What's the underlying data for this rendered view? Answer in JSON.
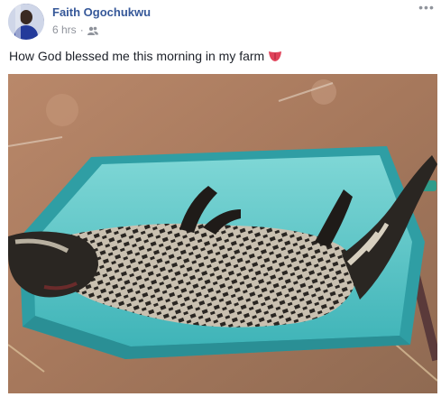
{
  "post": {
    "author_name": "Faith Ogochukwu",
    "timestamp": "6 hrs",
    "separator": "·",
    "audience_icon": "friends-icon",
    "more_icon": "ellipsis-icon",
    "more_label": "•••",
    "text": "How God blessed me this morning in my farm",
    "emoji_icon": "tongue-emoji-icon",
    "photo_subject": "civet-in-wheelbarrow-photo"
  },
  "colors": {
    "author_link": "#365899",
    "meta_gray": "#90949c",
    "body_text": "#1d2129"
  }
}
